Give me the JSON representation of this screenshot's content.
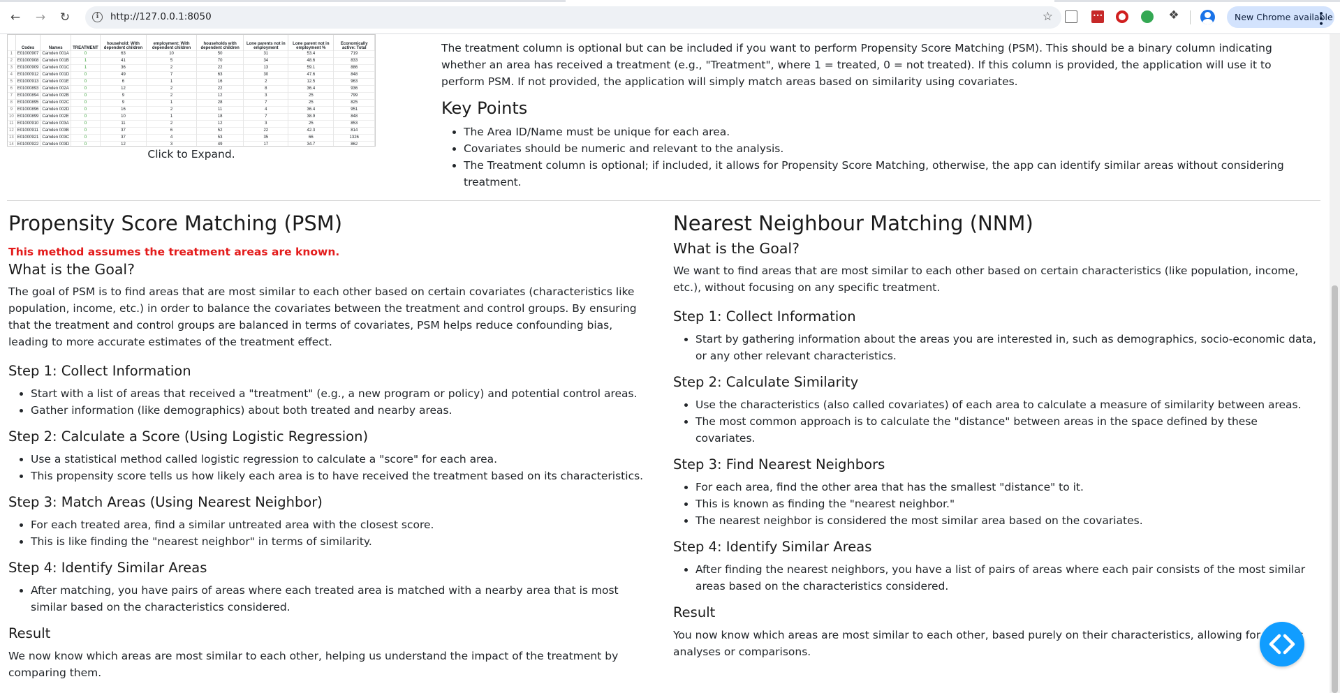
{
  "browser": {
    "url": "http://127.0.0.1:8050",
    "update_label": "New Chrome available"
  },
  "spreadsheet": {
    "headers": [
      "",
      "Codes",
      "Names",
      "TREATMENT",
      "household: With dependent children",
      "employment: With dependent children",
      "households with dependent children",
      "Lone parents not in employment",
      "Lone parent not in employment %",
      "Economically active: Total"
    ],
    "rows": [
      [
        "1",
        "E01000907",
        "Camden 001A",
        "0",
        "63",
        "10",
        "50",
        "31",
        "53.4",
        "719"
      ],
      [
        "2",
        "E01000908",
        "Camden 001B",
        "1",
        "41",
        "5",
        "70",
        "34",
        "48.6",
        "833"
      ],
      [
        "3",
        "E01000909",
        "Camden 001C",
        "1",
        "36",
        "2",
        "22",
        "13",
        "59.1",
        "886"
      ],
      [
        "4",
        "E01000912",
        "Camden 001D",
        "0",
        "49",
        "7",
        "63",
        "30",
        "47.6",
        "848"
      ],
      [
        "5",
        "E01000913",
        "Camden 001E",
        "0",
        "6",
        "1",
        "16",
        "2",
        "12.5",
        "963"
      ],
      [
        "6",
        "E01000893",
        "Camden 002A",
        "0",
        "12",
        "2",
        "22",
        "8",
        "36.4",
        "936"
      ],
      [
        "7",
        "E01000894",
        "Camden 002B",
        "0",
        "9",
        "2",
        "12",
        "3",
        "25",
        "799"
      ],
      [
        "8",
        "E01000895",
        "Camden 002C",
        "0",
        "9",
        "1",
        "28",
        "7",
        "25",
        "825"
      ],
      [
        "9",
        "E01000896",
        "Camden 002D",
        "0",
        "16",
        "2",
        "11",
        "4",
        "36.4",
        "951"
      ],
      [
        "10",
        "E01000899",
        "Camden 002E",
        "0",
        "10",
        "1",
        "18",
        "7",
        "38.9",
        "848"
      ],
      [
        "11",
        "E01000910",
        "Camden 003A",
        "0",
        "11",
        "2",
        "12",
        "3",
        "25",
        "853"
      ],
      [
        "12",
        "E01000911",
        "Camden 003B",
        "0",
        "37",
        "6",
        "52",
        "22",
        "42.3",
        "814"
      ],
      [
        "13",
        "E01000921",
        "Camden 003C",
        "0",
        "37",
        "4",
        "53",
        "35",
        "66",
        "1326"
      ],
      [
        "14",
        "E01000922",
        "Camden 003D",
        "0",
        "12",
        "3",
        "49",
        "17",
        "34.7",
        "862"
      ]
    ],
    "caption": "Click to Expand."
  },
  "intro": {
    "optional_text": "The treatment column is optional but can be included if you want to perform Propensity Score Matching (PSM). This should be a binary column indicating whether an area has received a treatment (e.g., \"Treatment\", where 1 = treated, 0 = not treated). If this column is provided, the application will use it to perform PSM. If not provided, the application will simply match areas based on similarity using covariates.",
    "key_points_title": "Key Points",
    "key_points": [
      "The Area ID/Name must be unique for each area.",
      "Covariates should be numeric and relevant to the analysis.",
      "The Treatment column is optional; if included, it allows for Propensity Score Matching, otherwise, the app can identify similar areas without considering treatment."
    ]
  },
  "psm": {
    "title": "Propensity Score Matching (PSM)",
    "warning": "This method assumes the treatment areas are known.",
    "goal_title": "What is the Goal?",
    "goal_text": "The goal of PSM is to find areas that are most similar to each other based on certain covariates (characteristics like population, income, etc.) in order to balance the covariates between the treatment and control groups. By ensuring that the treatment and control groups are balanced in terms of covariates, PSM helps reduce confounding bias, leading to more accurate estimates of the treatment effect.",
    "steps": [
      {
        "title": "Step 1: Collect Information",
        "items": [
          "Start with a list of areas that received a \"treatment\" (e.g., a new program or policy) and potential control areas.",
          "Gather information (like demographics) about both treated and nearby areas."
        ]
      },
      {
        "title": "Step 2: Calculate a Score (Using Logistic Regression)",
        "items": [
          "Use a statistical method called logistic regression to calculate a \"score\" for each area.",
          "This propensity score tells us how likely each area is to have received the treatment based on its characteristics."
        ]
      },
      {
        "title": "Step 3: Match Areas (Using Nearest Neighbor)",
        "items": [
          "For each treated area, find a similar untreated area with the closest score.",
          "This is like finding the \"nearest neighbor\" in terms of similarity."
        ]
      },
      {
        "title": "Step 4: Identify Similar Areas",
        "items": [
          "After matching, you have pairs of areas where each treated area is matched with a nearby area that is most similar based on the characteristics considered."
        ]
      }
    ],
    "result_title": "Result",
    "result_text": "We now know which areas are most similar to each other, helping us understand the impact of the treatment by comparing them."
  },
  "nnm": {
    "title": "Nearest Neighbour Matching (NNM)",
    "goal_title": "What is the Goal?",
    "goal_text": "We want to find areas that are most similar to each other based on certain characteristics (like population, income, etc.), without focusing on any specific treatment.",
    "steps": [
      {
        "title": "Step 1: Collect Information",
        "items": [
          "Start by gathering information about the areas you are interested in, such as demographics, socio-economic data, or any other relevant characteristics."
        ]
      },
      {
        "title": "Step 2: Calculate Similarity",
        "items": [
          "Use the characteristics (also called covariates) of each area to calculate a measure of similarity between areas.",
          "The most common approach is to calculate the \"distance\" between areas in the space defined by these covariates."
        ]
      },
      {
        "title": "Step 3: Find Nearest Neighbors",
        "items": [
          "For each area, find the other area that has the smallest \"distance\" to it.",
          "This is known as finding the \"nearest neighbor.\"",
          "The nearest neighbor is considered the most similar area based on the covariates."
        ]
      },
      {
        "title": "Step 4: Identify Similar Areas",
        "items": [
          "After finding the nearest neighbors, you have a list of pairs of areas where each pair consists of the most similar areas based on the characteristics considered."
        ]
      }
    ],
    "result_title": "Result",
    "result_text": "You now know which areas are most similar to each other, based purely on their characteristics, allowing for various analyses or comparisons."
  }
}
